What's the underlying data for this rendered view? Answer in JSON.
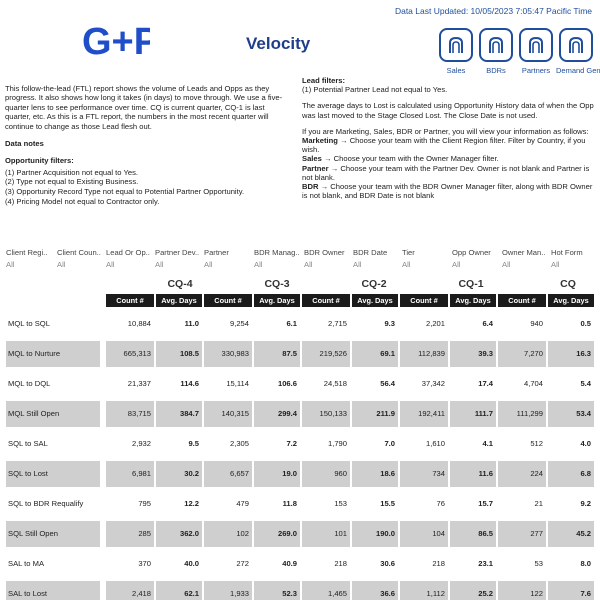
{
  "header": {
    "updated": "Data Last Updated: 10/05/2023 7:05:47 Pacific Time",
    "logo_text": "G+P",
    "title": "Velocity"
  },
  "nav": [
    {
      "label": "Sales"
    },
    {
      "label": "BDRs"
    },
    {
      "label": "Partners"
    },
    {
      "label": "Demand Gen"
    }
  ],
  "intro": {
    "p1": "This follow-the-lead (FTL) report shows the volume of Leads and Opps as they progress. It also shows how long it takes (in days) to move through. We use a five-quarter lens to see performance over time. CQ is current quarter, CQ-1 is last quarter, etc. As this is a FTL report, the numbers in the most recent quarter will continue to change as those Lead flesh out.",
    "data_notes": "Data notes",
    "opp_filters_title": "Opportunity filters:",
    "opp_filters": [
      "(1) Partner Acquisition not equal to Yes.",
      "(2) Type not equal to Existing Business.",
      "(3) Opportunity Record Type not equal to Potential Partner Opportunity.",
      "(4) Pricing Model not equal to Contractor only."
    ]
  },
  "right": {
    "lead_filters_title": "Lead filters:",
    "lead_filter": "(1) Potential Partner Lead not equal to Yes.",
    "avg_days": "The average days to Lost is calculated using Opportunity History data of when the Opp was last moved to the Stage Closed Lost. The Close Date is not used.",
    "if_you": "If you are Marketing, Sales, BDR or Partner, you will view your information as follows:",
    "marketing_b": "Marketing",
    "marketing": " → Choose your team with the Client Region filter. Filter by Country, if you wish.",
    "sales_b": "Sales",
    "sales": " → Choose your team with the Owner Manager filter.",
    "partner_b": "Partner",
    "partner": " → Choose your team with the Partner Dev. Owner is not blank and Partner is not blank.",
    "bdr_b": "BDR",
    "bdr": " → Choose your team with the BDR Owner Manager filter, along with BDR Owner is not blank, and BDR Date is not blank"
  },
  "filters": [
    {
      "label": "Client Regi..",
      "value": "All"
    },
    {
      "label": "Client Coun..",
      "value": "All"
    },
    {
      "label": "Lead Or Op..",
      "value": "All"
    },
    {
      "label": "Partner Dev..",
      "value": "All"
    },
    {
      "label": "Partner",
      "value": "All"
    },
    {
      "label": "BDR Manag..",
      "value": "All"
    },
    {
      "label": "BDR Owner",
      "value": "All"
    },
    {
      "label": "BDR Date",
      "value": "All"
    },
    {
      "label": "Tier",
      "value": "All"
    },
    {
      "label": "Opp Owner",
      "value": "All"
    },
    {
      "label": "Owner Man..",
      "value": "All"
    },
    {
      "label": "Hot Form",
      "value": "All"
    }
  ],
  "table": {
    "quarters": [
      "CQ-4",
      "CQ-3",
      "CQ-2",
      "CQ-1",
      "CQ"
    ],
    "col_count": "Count #",
    "col_avg": "Avg. Days",
    "rows": [
      {
        "label": "MQL to SQL",
        "vals": [
          "10,884",
          "11.0",
          "9,254",
          "6.1",
          "2,715",
          "9.3",
          "2,201",
          "6.4",
          "940",
          "0.5"
        ]
      },
      {
        "label": "MQL to Nurture",
        "vals": [
          "665,313",
          "108.5",
          "330,983",
          "87.5",
          "219,526",
          "69.1",
          "112,839",
          "39.3",
          "7,270",
          "16.3"
        ]
      },
      {
        "label": "MQL to DQL",
        "vals": [
          "21,337",
          "114.6",
          "15,114",
          "106.6",
          "24,518",
          "56.4",
          "37,342",
          "17.4",
          "4,704",
          "5.4"
        ]
      },
      {
        "label": "MQL Still Open",
        "vals": [
          "83,715",
          "384.7",
          "140,315",
          "299.4",
          "150,133",
          "211.9",
          "192,411",
          "111.7",
          "111,299",
          "53.4"
        ]
      },
      {
        "label": "SQL to SAL",
        "vals": [
          "2,932",
          "9.5",
          "2,305",
          "7.2",
          "1,790",
          "7.0",
          "1,610",
          "4.1",
          "512",
          "4.0"
        ]
      },
      {
        "label": "SQL to Lost",
        "vals": [
          "6,981",
          "30.2",
          "6,657",
          "19.0",
          "960",
          "18.6",
          "734",
          "11.6",
          "224",
          "6.8"
        ]
      },
      {
        "label": "SQL to BDR Requalify",
        "vals": [
          "795",
          "12.2",
          "479",
          "11.8",
          "153",
          "15.5",
          "76",
          "15.7",
          "21",
          "9.2"
        ]
      },
      {
        "label": "SQL Still Open",
        "vals": [
          "285",
          "362.0",
          "102",
          "269.0",
          "101",
          "190.0",
          "104",
          "86.5",
          "277",
          "45.2"
        ]
      },
      {
        "label": "SAL to MA",
        "vals": [
          "370",
          "40.0",
          "272",
          "40.9",
          "218",
          "30.6",
          "218",
          "23.1",
          "53",
          "8.0"
        ]
      },
      {
        "label": "SAL to Lost",
        "vals": [
          "2,418",
          "62.1",
          "1,933",
          "52.3",
          "1,465",
          "36.6",
          "1,112",
          "25.2",
          "122",
          "7.6"
        ]
      }
    ]
  }
}
